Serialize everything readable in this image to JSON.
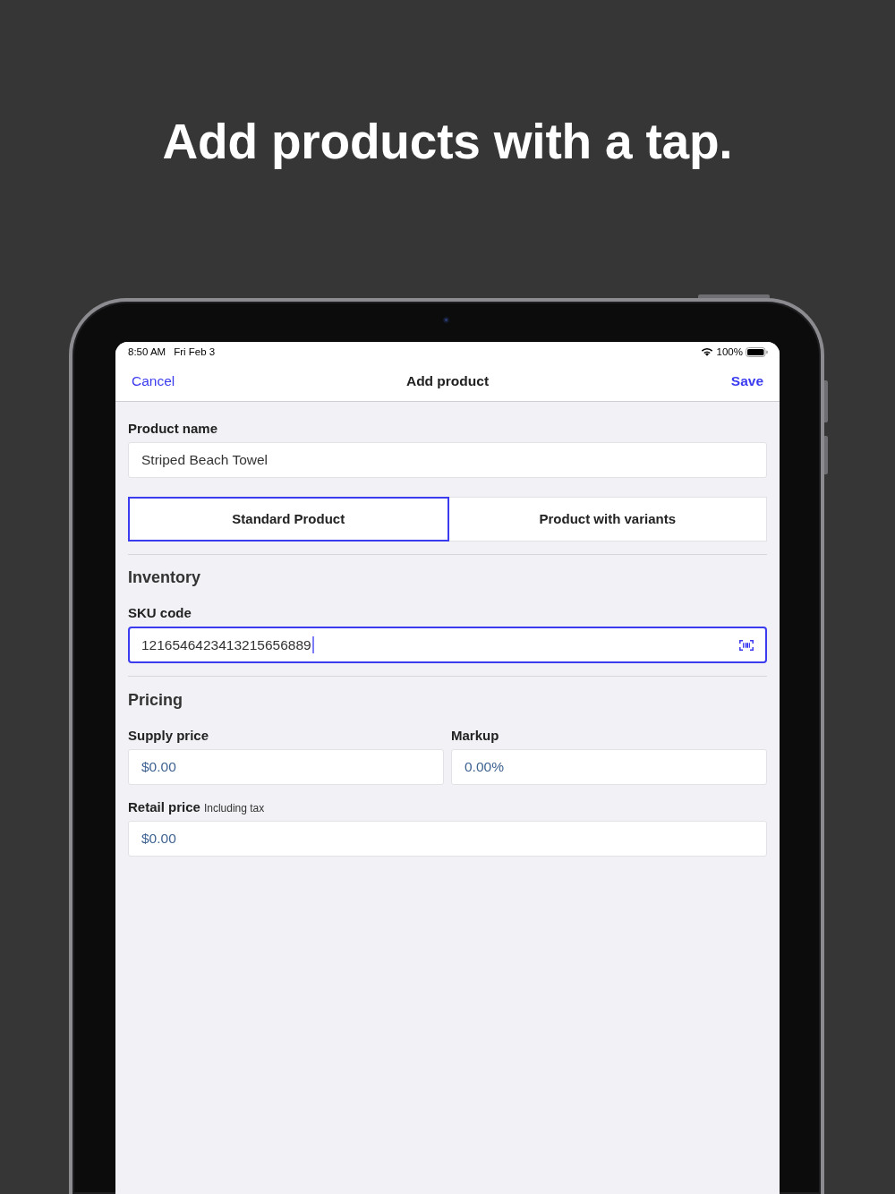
{
  "headline": "Add products with a tap.",
  "status_bar": {
    "time": "8:50 AM",
    "date": "Fri Feb 3",
    "battery": "100%"
  },
  "nav_bar": {
    "cancel": "Cancel",
    "title": "Add product",
    "save": "Save"
  },
  "product_name": {
    "label": "Product name",
    "value": "Striped Beach Towel"
  },
  "product_type": [
    {
      "label": "Standard Product",
      "selected": true
    },
    {
      "label": "Product with variants",
      "selected": false
    }
  ],
  "inventory": {
    "heading": "Inventory",
    "sku": {
      "label": "SKU code",
      "value": "1216546423413215656889",
      "focused": true
    }
  },
  "pricing": {
    "heading": "Pricing",
    "rows": [
      {
        "fields": [
          {
            "label": "Supply price",
            "value": "$0.00"
          },
          {
            "label": "Markup",
            "value": "0.00%"
          }
        ]
      },
      {
        "fields": [
          {
            "label": "Retail price",
            "note": "Including tax",
            "value": "$0.00"
          }
        ]
      }
    ]
  }
}
